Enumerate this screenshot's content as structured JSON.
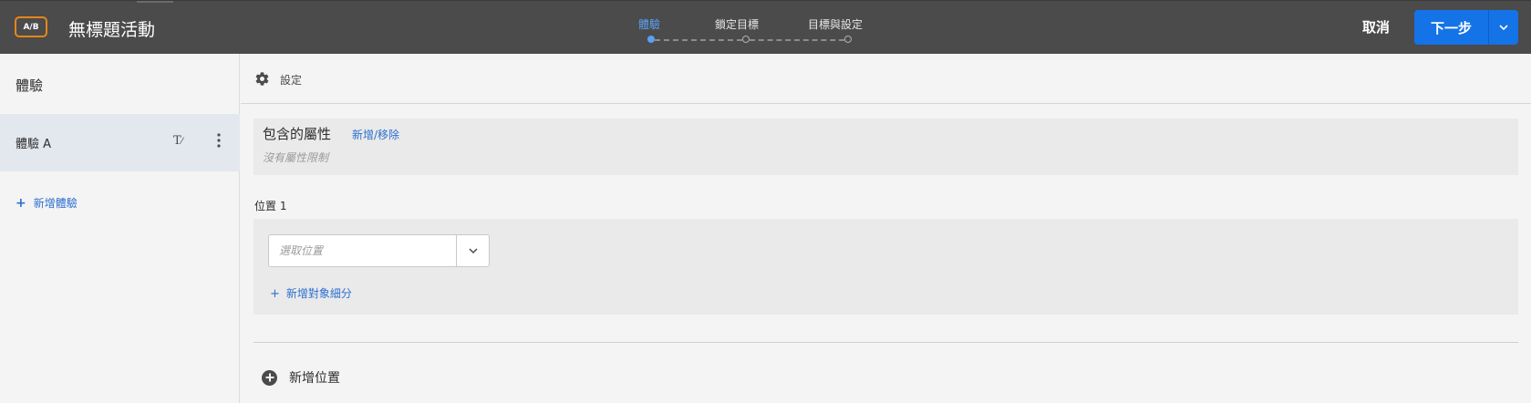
{
  "header": {
    "badge": "A/B",
    "title": "無標題活動",
    "steps": [
      {
        "label": "體驗",
        "active": true
      },
      {
        "label": "鎖定目標",
        "active": false
      },
      {
        "label": "目標與設定",
        "active": false
      }
    ],
    "cancel_label": "取消",
    "next_label": "下一步"
  },
  "sidebar": {
    "heading": "體驗",
    "items": [
      {
        "label": "體驗 A",
        "selected": true
      }
    ],
    "rename_glyph": "T⁄",
    "add_label": "新增體驗"
  },
  "main": {
    "settings_label": "設定",
    "properties": {
      "title": "包含的屬性",
      "link": "新增/移除",
      "note": "沒有屬性限制"
    },
    "location": {
      "label": "位置 1",
      "placeholder": "選取位置",
      "value": "",
      "add_audience": "新增對象細分"
    },
    "add_location": "新增位置"
  },
  "colors": {
    "topbar": "#4b4b4b",
    "accent_blue": "#1473e6",
    "active_step": "#5aa0f5",
    "badge_orange": "#e68619",
    "link": "#2d6fcf"
  },
  "icons": [
    "gear-icon",
    "more-vertical-icon",
    "rename-icon",
    "chevron-down-icon",
    "plus-icon",
    "add-circle-icon"
  ]
}
